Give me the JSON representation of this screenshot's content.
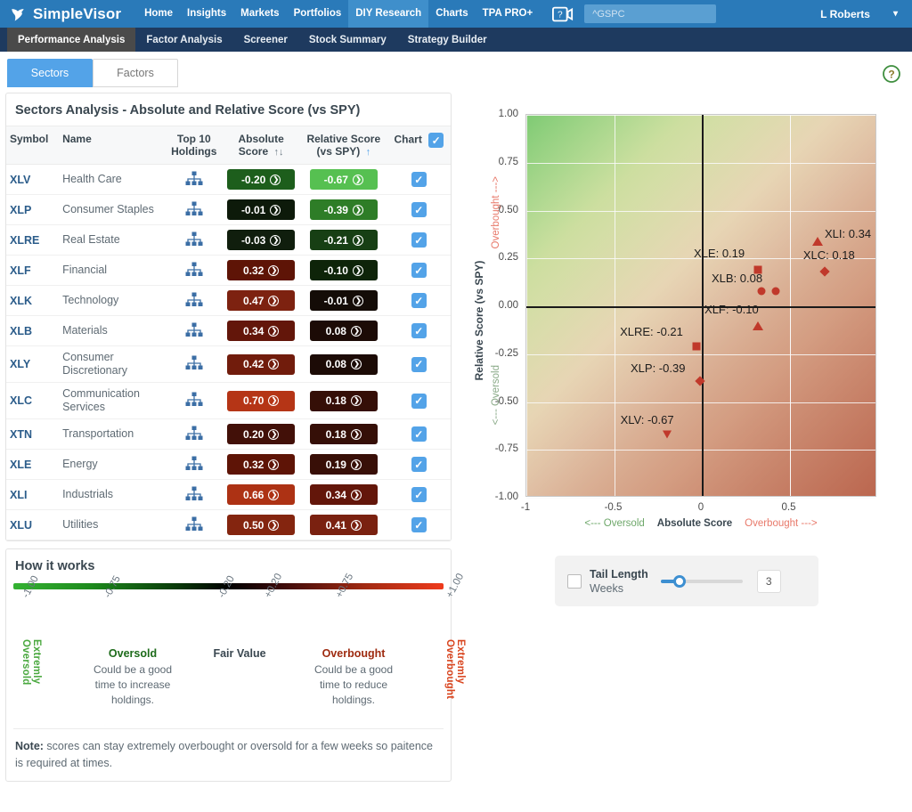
{
  "topnav": {
    "brand": "SimpleVisor",
    "items": [
      {
        "label": "Home",
        "active": false
      },
      {
        "label": "Insights",
        "active": false
      },
      {
        "label": "Markets",
        "active": false
      },
      {
        "label": "Portfolios",
        "active": false
      },
      {
        "label": "DIY Research",
        "active": true
      },
      {
        "label": "Charts",
        "active": false
      },
      {
        "label": "TPA PRO+",
        "active": false
      }
    ],
    "help_icon": "video-help-icon",
    "search_value": "^GSPC",
    "user": "L Roberts",
    "user_caret": "▾",
    "accent": "#2a7ab9"
  },
  "subnav": {
    "items": [
      {
        "label": "Performance Analysis",
        "active": true
      },
      {
        "label": "Factor Analysis",
        "active": false
      },
      {
        "label": "Screener",
        "active": false
      },
      {
        "label": "Stock Summary",
        "active": false
      },
      {
        "label": "Strategy Builder",
        "active": false
      }
    ]
  },
  "tabs": {
    "items": [
      {
        "label": "Sectors",
        "active": true
      },
      {
        "label": "Factors",
        "active": false
      }
    ],
    "help": "?"
  },
  "table_panel": {
    "title": "Sectors Analysis - Absolute and Relative Score (vs SPY)",
    "headers": {
      "symbol": "Symbol",
      "name": "Name",
      "top_line1": "Top 10",
      "top_line2": "Holdings",
      "abs_line1": "Absolute",
      "abs_line2": "Score",
      "abs_sort": "↑↓",
      "rel_line1": "Relative Score",
      "rel_line2": "(vs SPY)",
      "rel_sort": "↑",
      "chart": "Chart",
      "chart_check": "✓"
    },
    "rows": [
      {
        "symbol": "XLV",
        "name": "Health Care",
        "abs": "-0.20",
        "rel": "-0.67",
        "abs_color": "#1d5e1c",
        "rel_color": "#56c051",
        "checked": true
      },
      {
        "symbol": "XLP",
        "name": "Consumer Staples",
        "abs": "-0.01",
        "rel": "-0.39",
        "abs_color": "#0d1a0a",
        "rel_color": "#2e7d27",
        "checked": true
      },
      {
        "symbol": "XLRE",
        "name": "Real Estate",
        "abs": "-0.03",
        "rel": "-0.21",
        "abs_color": "#101e0d",
        "rel_color": "#173f14",
        "checked": true
      },
      {
        "symbol": "XLF",
        "name": "Financial",
        "abs": "0.32",
        "rel": "-0.10",
        "abs_color": "#5e1406",
        "rel_color": "#0e2409",
        "checked": true
      },
      {
        "symbol": "XLK",
        "name": "Technology",
        "abs": "0.47",
        "rel": "-0.01",
        "abs_color": "#7d2210",
        "rel_color": "#140c07",
        "checked": true
      },
      {
        "symbol": "XLB",
        "name": "Materials",
        "abs": "0.34",
        "rel": "0.08",
        "abs_color": "#63160a",
        "rel_color": "#1c0b06",
        "checked": true
      },
      {
        "symbol": "XLY",
        "name": "Consumer Discretionary",
        "abs": "0.42",
        "rel": "0.08",
        "abs_color": "#711c0c",
        "rel_color": "#1c0b06",
        "checked": true
      },
      {
        "symbol": "XLC",
        "name": "Communication Services",
        "abs": "0.70",
        "rel": "0.18",
        "abs_color": "#b53516",
        "rel_color": "#350f07",
        "checked": true
      },
      {
        "symbol": "XTN",
        "name": "Transportation",
        "abs": "0.20",
        "rel": "0.18",
        "abs_color": "#421008",
        "rel_color": "#350f07",
        "checked": true
      },
      {
        "symbol": "XLE",
        "name": "Energy",
        "abs": "0.32",
        "rel": "0.19",
        "abs_color": "#5e1406",
        "rel_color": "#380f07",
        "checked": true
      },
      {
        "symbol": "XLI",
        "name": "Industrials",
        "abs": "0.66",
        "rel": "0.34",
        "abs_color": "#ad3214",
        "rel_color": "#63160a",
        "checked": true
      },
      {
        "symbol": "XLU",
        "name": "Utilities",
        "abs": "0.50",
        "rel": "0.41",
        "abs_color": "#84250f",
        "rel_color": "#7a2110",
        "checked": true
      }
    ]
  },
  "how_it_works": {
    "title": "How it works",
    "ticks": [
      "-1.00",
      "-0.75",
      "-0.20",
      "+0.20",
      "+0.75",
      "+1.00"
    ],
    "left_vertical": "Extremly Oversold",
    "right_vertical": "Extremly Overbought",
    "left_vertical_color": "#4aa83f",
    "right_vertical_color": "#d9451f",
    "blocks": [
      {
        "title": "Oversold",
        "body": "Could be a good time to increase holdings.",
        "color": "#1d6b1a"
      },
      {
        "title": "Fair Value",
        "body": "",
        "color": "#3a4750"
      },
      {
        "title": "Overbought",
        "body": "Could be a good time to reduce holdings.",
        "color": "#9e2b10"
      }
    ],
    "note_label": "Note:",
    "note_text": " scores can stay extremely overbought or oversold for a few weeks so paitence is required at times."
  },
  "chart_data": {
    "type": "scatter",
    "title": "",
    "xlabel": "Absolute Score",
    "ylabel": "Relative Score (vs SPY)",
    "xlim": [
      -1,
      1
    ],
    "ylim": [
      -1,
      1
    ],
    "xticks": [
      "-1",
      "-0.5",
      "0",
      "0.5"
    ],
    "xtick_values": [
      -1,
      -0.5,
      0,
      0.5
    ],
    "yticks": [
      "1.00",
      "0.75",
      "0.50",
      "0.25",
      "0.00",
      "-0.25",
      "-0.50",
      "-0.75",
      "-1.00"
    ],
    "ytick_values": [
      1.0,
      0.75,
      0.5,
      0.25,
      0.0,
      -0.25,
      -0.5,
      -0.75,
      -1.0
    ],
    "grid": true,
    "legend": "none",
    "axis_annotations": {
      "x_left": "<--- Oversold",
      "x_center": "Absolute Score",
      "x_right": "Overbought --->",
      "y_upper": "Overbought --->",
      "y_lower": "<--- Oversold"
    },
    "marker_color": "#c0392b",
    "points": [
      {
        "label": "XLI: 0.34",
        "symbol": "XLI",
        "x": 0.66,
        "y": 0.34,
        "marker": "tri-up",
        "label_dx": 8,
        "label_dy": -16
      },
      {
        "label": "XLC: 0.18",
        "symbol": "XLC",
        "x": 0.7,
        "y": 0.18,
        "marker": "diamond",
        "label_dx": -24,
        "label_dy": -26
      },
      {
        "label": "XLE: 0.19",
        "symbol": "XLE",
        "x": 0.32,
        "y": 0.19,
        "marker": "square",
        "label_dx": -72,
        "label_dy": -26
      },
      {
        "label": "XLB: 0.08",
        "symbol": "XLB",
        "x": 0.34,
        "y": 0.08,
        "marker": "circle",
        "label_dx": -56,
        "label_dy": -22
      },
      {
        "label": "",
        "symbol": "XLY",
        "x": 0.42,
        "y": 0.08,
        "marker": "circle",
        "label_dx": 0,
        "label_dy": 0
      },
      {
        "label": "XLF: -0.10",
        "symbol": "XLF",
        "x": 0.32,
        "y": -0.1,
        "marker": "tri-up",
        "label_dx": -60,
        "label_dy": -26
      },
      {
        "label": "XLRE: -0.21",
        "symbol": "XLRE",
        "x": -0.03,
        "y": -0.21,
        "marker": "square",
        "label_dx": -86,
        "label_dy": -24
      },
      {
        "label": "XLP: -0.39",
        "symbol": "XLP",
        "x": -0.01,
        "y": -0.39,
        "marker": "diamond",
        "label_dx": -78,
        "label_dy": -22
      },
      {
        "label": "XLV: -0.67",
        "symbol": "XLV",
        "x": -0.2,
        "y": -0.67,
        "marker": "tri-down",
        "label_dx": -52,
        "label_dy": -24
      }
    ]
  },
  "tail_control": {
    "label": "Tail Length",
    "sublabel": "Weeks",
    "value": "3",
    "checked": false
  }
}
